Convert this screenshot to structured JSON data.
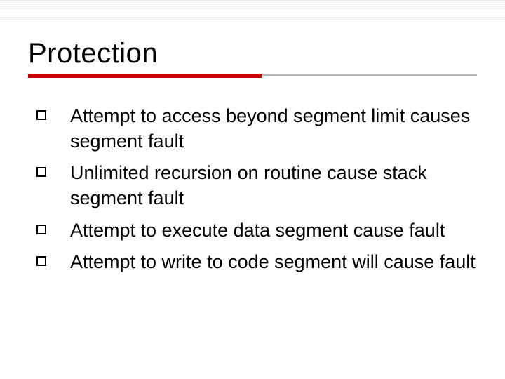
{
  "slide": {
    "title": "Protection",
    "accent_color": "#cc0000",
    "bullets": [
      "Attempt to access beyond segment limit causes segment fault",
      "Unlimited recursion on routine cause stack segment fault",
      "Attempt to execute data segment cause fault",
      "Attempt to write to code segment will cause fault"
    ]
  }
}
